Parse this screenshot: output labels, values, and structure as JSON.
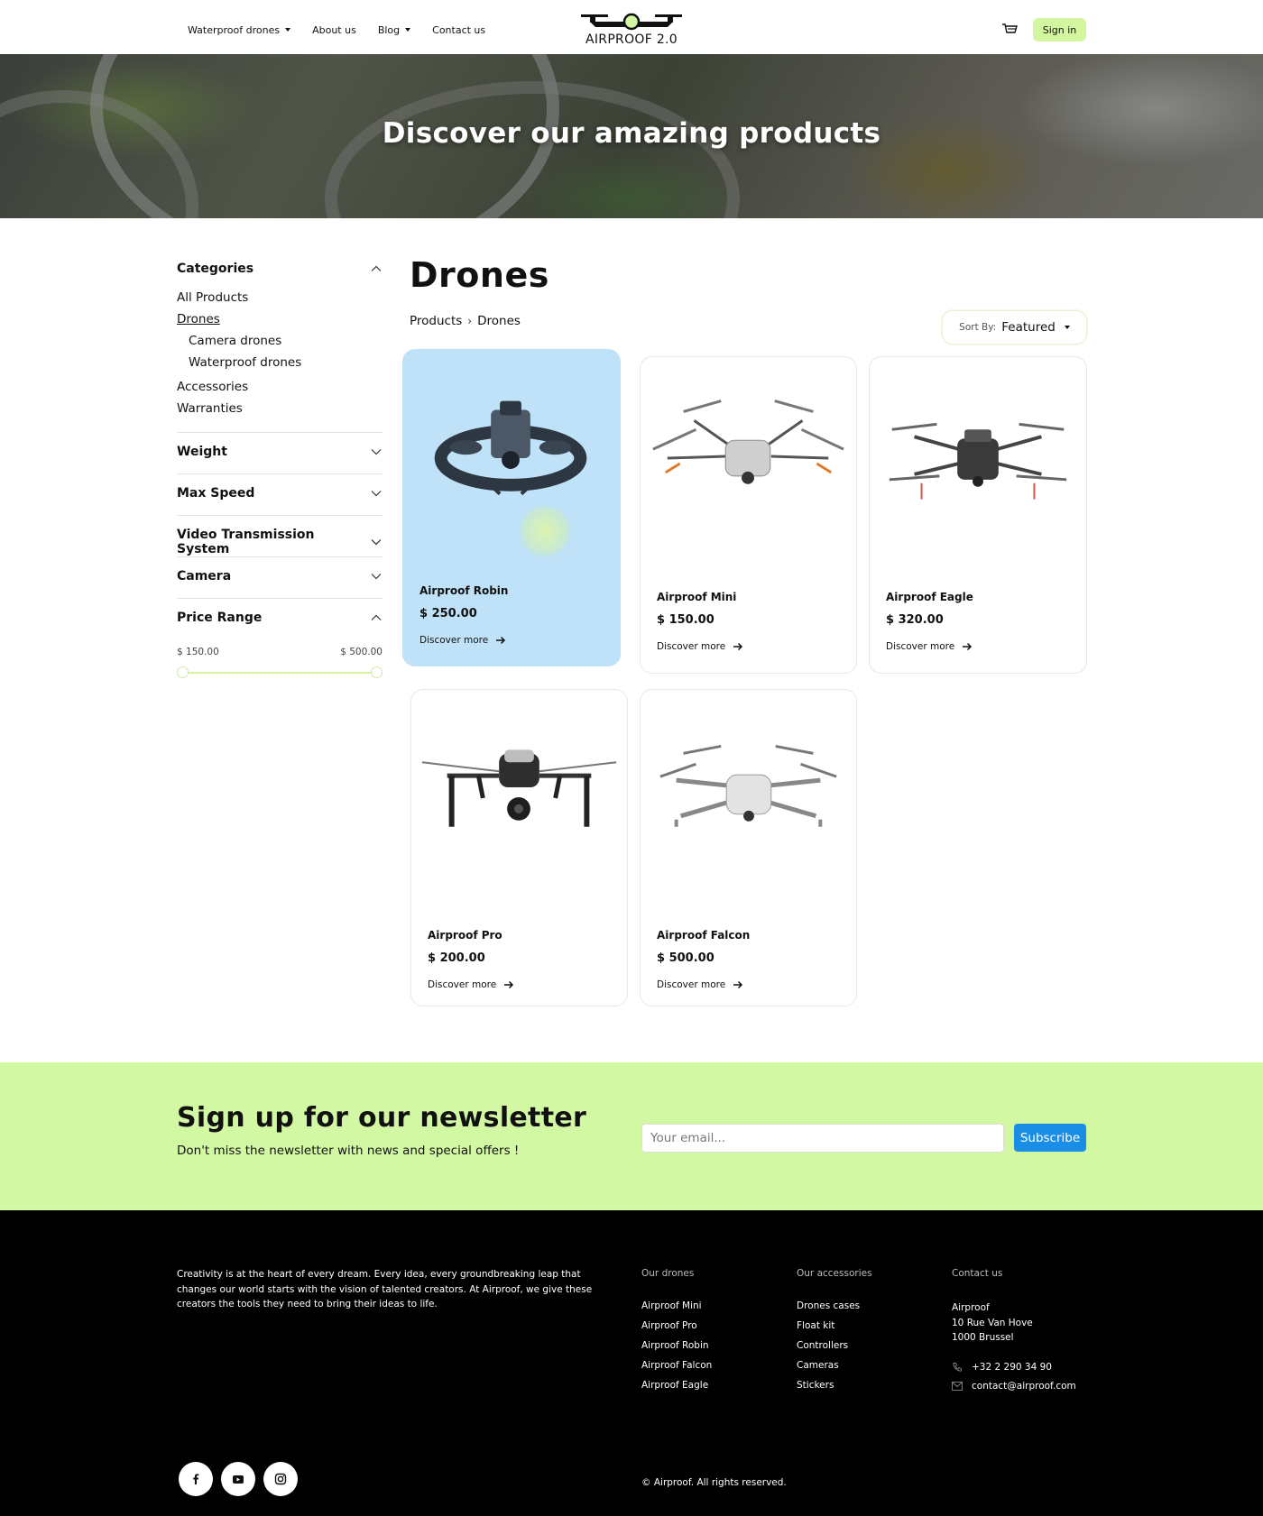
{
  "header": {
    "nav": [
      {
        "label": "Waterproof drones",
        "dropdown": true
      },
      {
        "label": "About us",
        "dropdown": false
      },
      {
        "label": "Blog",
        "dropdown": true
      },
      {
        "label": "Contact us",
        "dropdown": false
      }
    ],
    "logo_text": "AIRPROOF 2.0",
    "signin_label": "Sign in"
  },
  "hero": {
    "title": "Discover our amazing products"
  },
  "sidebar": {
    "categories_title": "Categories",
    "categories": [
      {
        "label": "All Products"
      },
      {
        "label": "Drones",
        "active": true
      },
      {
        "label": "Camera drones",
        "sub": true
      },
      {
        "label": "Waterproof drones",
        "sub": true
      },
      {
        "label": "Accessories"
      },
      {
        "label": "Warranties"
      }
    ],
    "filters": [
      "Weight",
      "Max Speed",
      "Video Transmission System",
      "Camera",
      "Price Range"
    ],
    "price_min": "$ 150.00",
    "price_max": "$ 500.00"
  },
  "main": {
    "title": "Drones",
    "breadcrumb": [
      "Products",
      "Drones"
    ],
    "sort_label": "Sort By:",
    "sort_value": "Featured"
  },
  "products": [
    {
      "name": "Airproof Robin",
      "price": "$ 250.00",
      "cta": "Discover more"
    },
    {
      "name": "Airproof Mini",
      "price": "$ 150.00",
      "cta": "Discover more"
    },
    {
      "name": "Airproof Eagle",
      "price": "$ 320.00",
      "cta": "Discover more"
    },
    {
      "name": "Airproof Pro",
      "price": "$ 200.00",
      "cta": "Discover more"
    },
    {
      "name": "Airproof Falcon",
      "price": "$ 500.00",
      "cta": "Discover more"
    }
  ],
  "newsletter": {
    "title": "Sign up for our newsletter",
    "subtitle": "Don't miss the newsletter with news and special offers !",
    "placeholder": "Your email...",
    "button": "Subscribe"
  },
  "footer": {
    "about": "Creativity is at the heart of every dream. Every idea, every groundbreaking leap that changes our world starts with the vision of talented creators. At Airproof, we give these creators the tools they need to bring their ideas to life.",
    "drones_title": "Our drones",
    "drones": [
      "Airproof Mini",
      "Airproof Pro",
      "Airproof Robin",
      "Airproof Falcon",
      "Airproof Eagle"
    ],
    "accessories_title": "Our accessories",
    "accessories": [
      "Drones cases",
      "Float kit",
      "Controllers",
      "Cameras",
      "Stickers"
    ],
    "contact_title": "Contact us",
    "address": [
      "Airproof",
      "10 Rue Van Hove",
      "1000 Brussel"
    ],
    "phone": "+32 2 290 34 90",
    "email": "contact@airproof.com",
    "copyright": "© Airproof. All rights reserved.",
    "social": [
      "facebook-icon",
      "youtube-icon",
      "instagram-icon"
    ]
  },
  "colors": {
    "accent_green": "#d3f8a3",
    "highlight_blue": "#bfe2f8",
    "subscribe_blue": "#1a8ee6"
  }
}
